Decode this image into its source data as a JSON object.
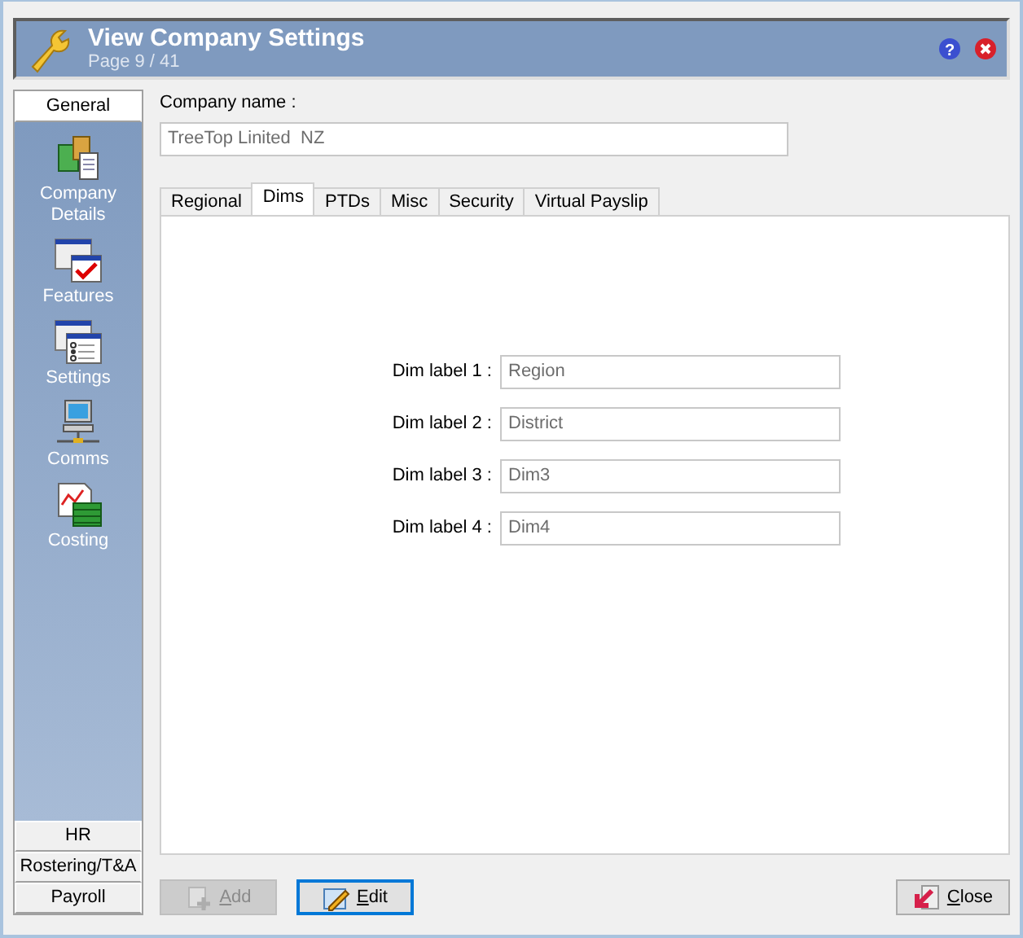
{
  "header": {
    "title": "View Company Settings",
    "subtitle": "Page 9 / 41",
    "help_glyph": "?"
  },
  "sidebar": {
    "sections": [
      {
        "label": "General",
        "expanded": true,
        "items": [
          {
            "label": "Company Details",
            "kind": "company"
          },
          {
            "label": "Features",
            "kind": "features"
          },
          {
            "label": "Settings",
            "kind": "settings"
          },
          {
            "label": "Comms",
            "kind": "comms"
          },
          {
            "label": "Costing",
            "kind": "costing"
          }
        ]
      },
      {
        "label": "HR",
        "expanded": false
      },
      {
        "label": "Rostering/T&A",
        "expanded": false
      },
      {
        "label": "Payroll",
        "expanded": false
      }
    ]
  },
  "company_name": {
    "label": "Company name :",
    "value": "TreeTop Linited  NZ"
  },
  "tabs": [
    {
      "label": "Regional",
      "selected": false
    },
    {
      "label": "Dims",
      "selected": true
    },
    {
      "label": "PTDs",
      "selected": false
    },
    {
      "label": "Misc",
      "selected": false
    },
    {
      "label": "Security",
      "selected": false
    },
    {
      "label": "Virtual Payslip",
      "selected": false
    }
  ],
  "dims": [
    {
      "label": "Dim label 1 :",
      "value": "Region"
    },
    {
      "label": "Dim label 2 :",
      "value": "District"
    },
    {
      "label": "Dim label 3 :",
      "value": "Dim3"
    },
    {
      "label": "Dim label 4 :",
      "value": "Dim4"
    }
  ],
  "buttons": [
    {
      "label": "Add",
      "kind": "add",
      "disabled": true
    },
    {
      "label": "Edit",
      "kind": "edit",
      "disabled": false
    },
    {
      "label": "Close",
      "kind": "close",
      "disabled": false
    }
  ]
}
